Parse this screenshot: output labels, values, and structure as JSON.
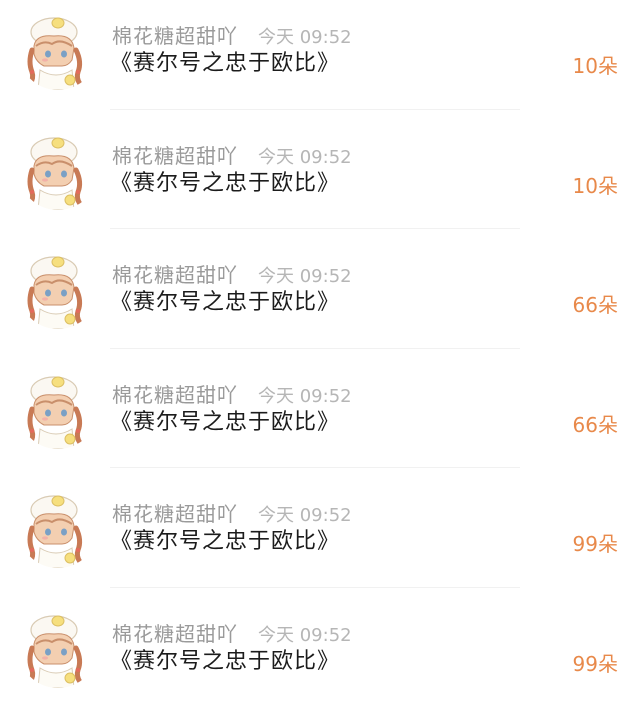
{
  "messages": [
    {
      "name": "棉花糖超甜吖",
      "time": "今天 09:52",
      "title": "《赛尔号之忠于欧比》",
      "amount": "10朵"
    },
    {
      "name": "棉花糖超甜吖",
      "time": "今天 09:52",
      "title": "《赛尔号之忠于欧比》",
      "amount": "10朵"
    },
    {
      "name": "棉花糖超甜吖",
      "time": "今天 09:52",
      "title": "《赛尔号之忠于欧比》",
      "amount": "66朵"
    },
    {
      "name": "棉花糖超甜吖",
      "time": "今天 09:52",
      "title": "《赛尔号之忠于欧比》",
      "amount": "66朵"
    },
    {
      "name": "棉花糖超甜吖",
      "time": "今天 09:52",
      "title": "《赛尔号之忠于欧比》",
      "amount": "99朵"
    },
    {
      "name": "棉花糖超甜吖",
      "time": "今天 09:52",
      "title": "《赛尔号之忠于欧比》",
      "amount": "99朵"
    }
  ],
  "colors": {
    "name": "#9a9a9a",
    "time": "#b6b6b6",
    "title": "#1c1c1c",
    "amount": "#e8894a",
    "divider": "#f1f1f1"
  },
  "icons": {
    "avatar": "anime-girl-avatar-icon"
  }
}
